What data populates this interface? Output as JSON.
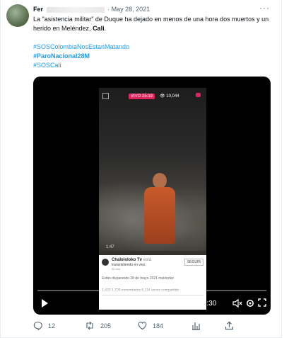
{
  "tweet": {
    "author_name": "Fer",
    "dot": "·",
    "date": "May 28, 2021",
    "text_main": "La \"asistencia militar\" de Duque ha dejado en menos de una hora dos muertos y un herido en Meléndez, ",
    "text_bold": "Cali",
    "text_end": ".",
    "hashtags": [
      "#SOSColombiaNosEstanMatando",
      "#ParoNacional28M",
      "#SOSCali"
    ]
  },
  "media": {
    "overlay": {
      "live_label": "VIVO 25:18",
      "views": "10,044",
      "timestamp": "1:47",
      "page_name": "Chalololoko Tv",
      "page_name_suffix": "está",
      "line2": "transmitiendo en vivo.",
      "line3": "25 min ·",
      "follow_label": "SEGUIR",
      "description": "Están disparando 28 de mayo 2021  meléndez",
      "reactions": "1,422     1,720 comentarios  6,114 veces compartido"
    },
    "time": "0:00 / 0:30",
    "progress": 0.0
  },
  "actions": {
    "replies": "12",
    "retweets": "205",
    "likes": "184"
  },
  "colors": {
    "link": "#1d9bf0",
    "muted": "#536471",
    "live": "#e0245e"
  }
}
